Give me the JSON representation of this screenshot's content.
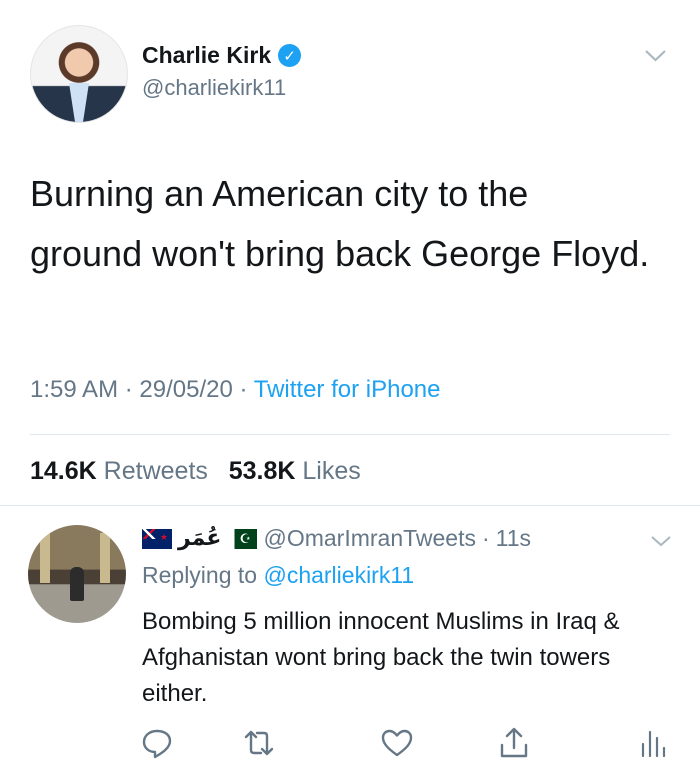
{
  "tweet": {
    "display_name": "Charlie Kirk",
    "handle": "@charliekirk11",
    "text": "Burning an American city to the ground won't bring back George Floyd.",
    "time": "1:59 AM",
    "date": "29/05/20",
    "source": "Twitter for iPhone",
    "retweets_count": "14.6K",
    "retweets_label": "Retweets",
    "likes_count": "53.8K",
    "likes_label": "Likes"
  },
  "reply": {
    "name_text": "عُمَر",
    "handle": "@OmarImranTweets",
    "time_ago": "11s",
    "replying_to_label": "Replying to",
    "replying_to_handle": "@charliekirk11",
    "text": "Bombing 5 million innocent Muslims in Iraq & Afghanistan wont bring back the twin towers either."
  },
  "colors": {
    "accent": "#1da1f2",
    "secondary_text": "#657786",
    "primary_text": "#14171a"
  },
  "icons": {
    "verified": "verified-badge-icon",
    "caret": "chevron-down-icon",
    "reply": "reply-icon",
    "retweet": "retweet-icon",
    "like": "heart-icon",
    "share": "share-icon",
    "analytics": "analytics-icon"
  }
}
